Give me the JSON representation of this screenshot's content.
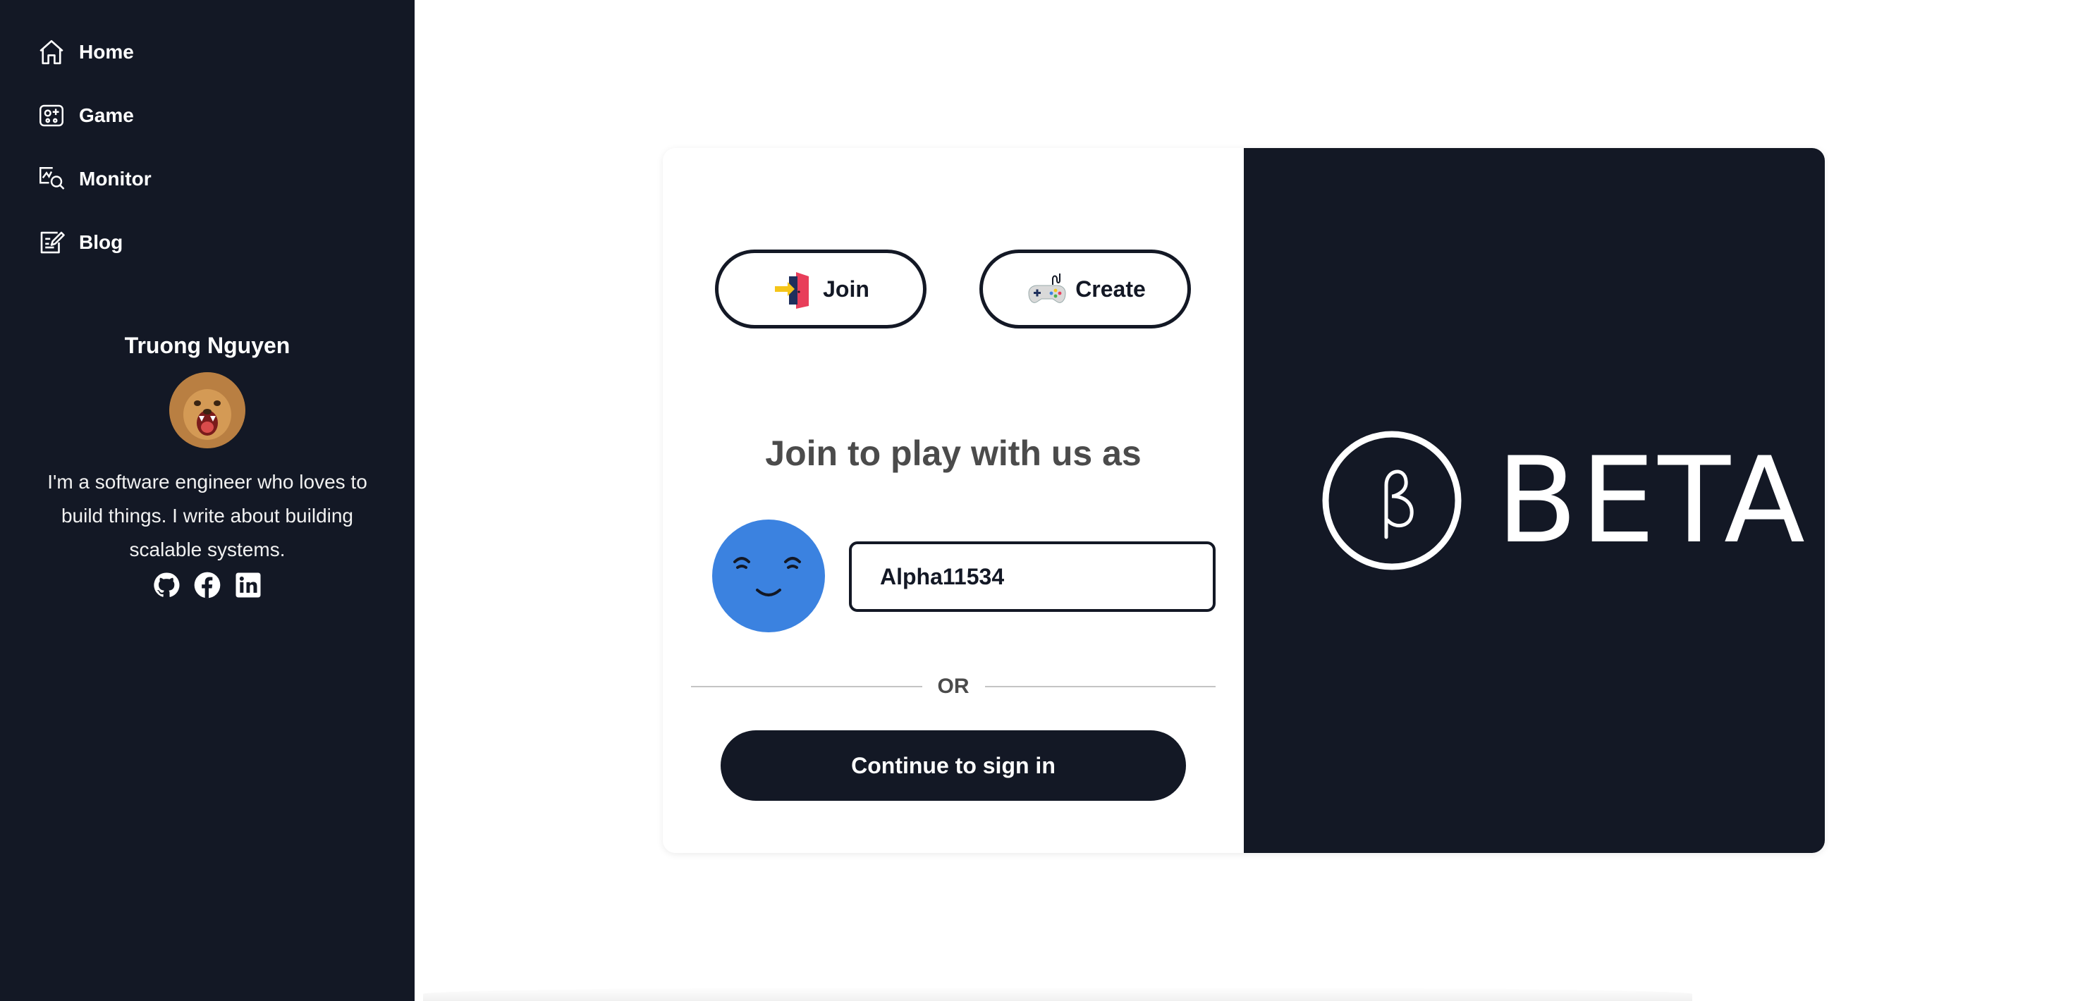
{
  "sidebar": {
    "nav": [
      {
        "label": "Home",
        "icon": "home-icon"
      },
      {
        "label": "Game",
        "icon": "game-icon"
      },
      {
        "label": "Monitor",
        "icon": "monitor-icon"
      },
      {
        "label": "Blog",
        "icon": "blog-icon"
      }
    ],
    "profile": {
      "name": "Truong Nguyen",
      "bio": "I'm a software engineer who loves to build things. I write about building scalable systems.",
      "socials": [
        "github-icon",
        "facebook-icon",
        "linkedin-icon"
      ]
    }
  },
  "card": {
    "join_label": "Join",
    "create_label": "Create",
    "heading": "Join to play with us as",
    "username_value": "Alpha11534",
    "or_label": "OR",
    "signin_label": "Continue to sign in",
    "brand_text": "BETA"
  },
  "colors": {
    "dark": "#131825",
    "avatar_face": "#3b82e0",
    "join_door": "#e83e5a",
    "join_arrow": "#f5c518"
  }
}
